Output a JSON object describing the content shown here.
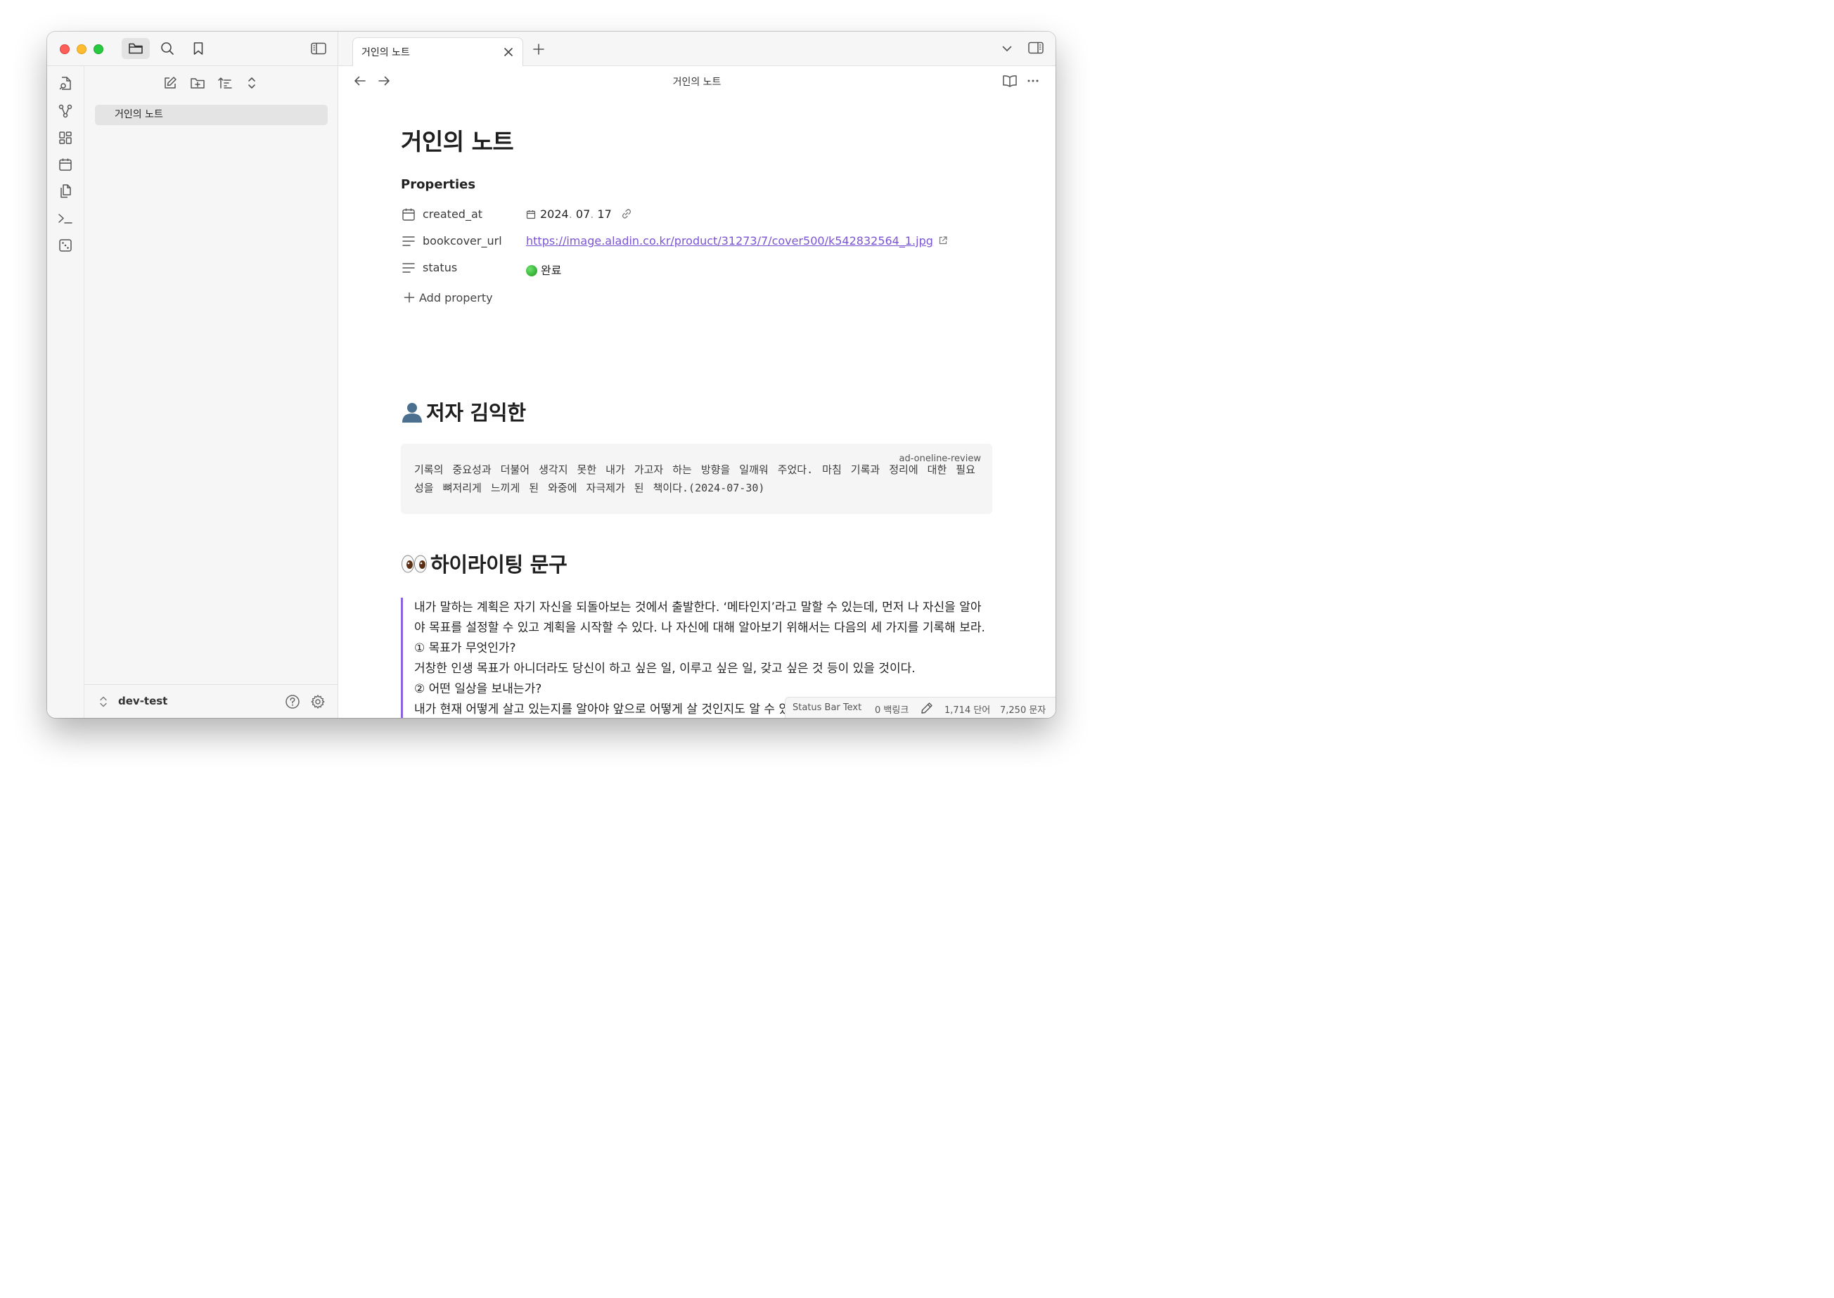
{
  "sidebar": {
    "file_item": "거인의 노트",
    "vault_name": "dev-test"
  },
  "tabs": [
    {
      "title": "거인의 노트"
    }
  ],
  "header": {
    "title": "거인의 노트"
  },
  "note": {
    "title": "거인의 노트",
    "properties_heading": "Properties",
    "properties": [
      {
        "key": "created_at",
        "icon": "calendar-icon",
        "value_parts": [
          "2024",
          ". ",
          "07",
          ". ",
          "17"
        ]
      },
      {
        "key": "bookcover_url",
        "icon": "text-lines-icon",
        "value": "https://image.aladin.co.kr/product/31273/7/cover500/k542832564_1.jpg"
      },
      {
        "key": "status",
        "icon": "text-lines-icon",
        "value": "완료"
      }
    ],
    "add_property_label": "Add property",
    "author_heading": "저자 김익한",
    "code_block": {
      "language": "ad-oneline-review",
      "text": "기록의 중요성과 더불어 생각지 못한 내가 가고자 하는 방향을 일깨워 주었다. 마침 기록과 정리에 대한 필요성을 뼈저리게 느끼게 된 와중에 자극제가 된 책이다.(2024-07-30)"
    },
    "highlight_heading": "하이라이팅 문구",
    "quote_lines": [
      "내가 말하는 계획은 자기 자신을 되돌아보는 것에서 출발한다. ‘메타인지’라고 말할 수 있는데, 먼저 나 자신을 알아야 목표를 설정할 수 있고 계획을 시작할 수 있다. 나 자신에 대해 알아보기 위해서는 다음의 세 가지를 기록해 보라.",
      "① 목표가 무엇인가?",
      "거창한 인생 목표가 아니더라도 당신이 하고 싶은 일, 이루고 싶은 일, 갖고 싶은 것 등이 있을 것이다.",
      "② 어떤 일상을 보내는가?",
      "내가 현재 어떻게 살고 있는지를 알아야 앞으로 어떻게 살 것인지도 알 수 있다. 일상에는 일, 취미, 휴식 등 다양한 영역이 있다. 그 시간을 어떻게 채우고 있는가?"
    ]
  },
  "status_bar": {
    "text": "Status Bar Text",
    "backlinks": "0 백링크",
    "words": "1,714 단어",
    "chars": "7,250 문자"
  },
  "colors": {
    "accent": "#7b54d6",
    "traffic_red": "#ff5f57",
    "traffic_yellow": "#febc2e",
    "traffic_green": "#28c840"
  }
}
